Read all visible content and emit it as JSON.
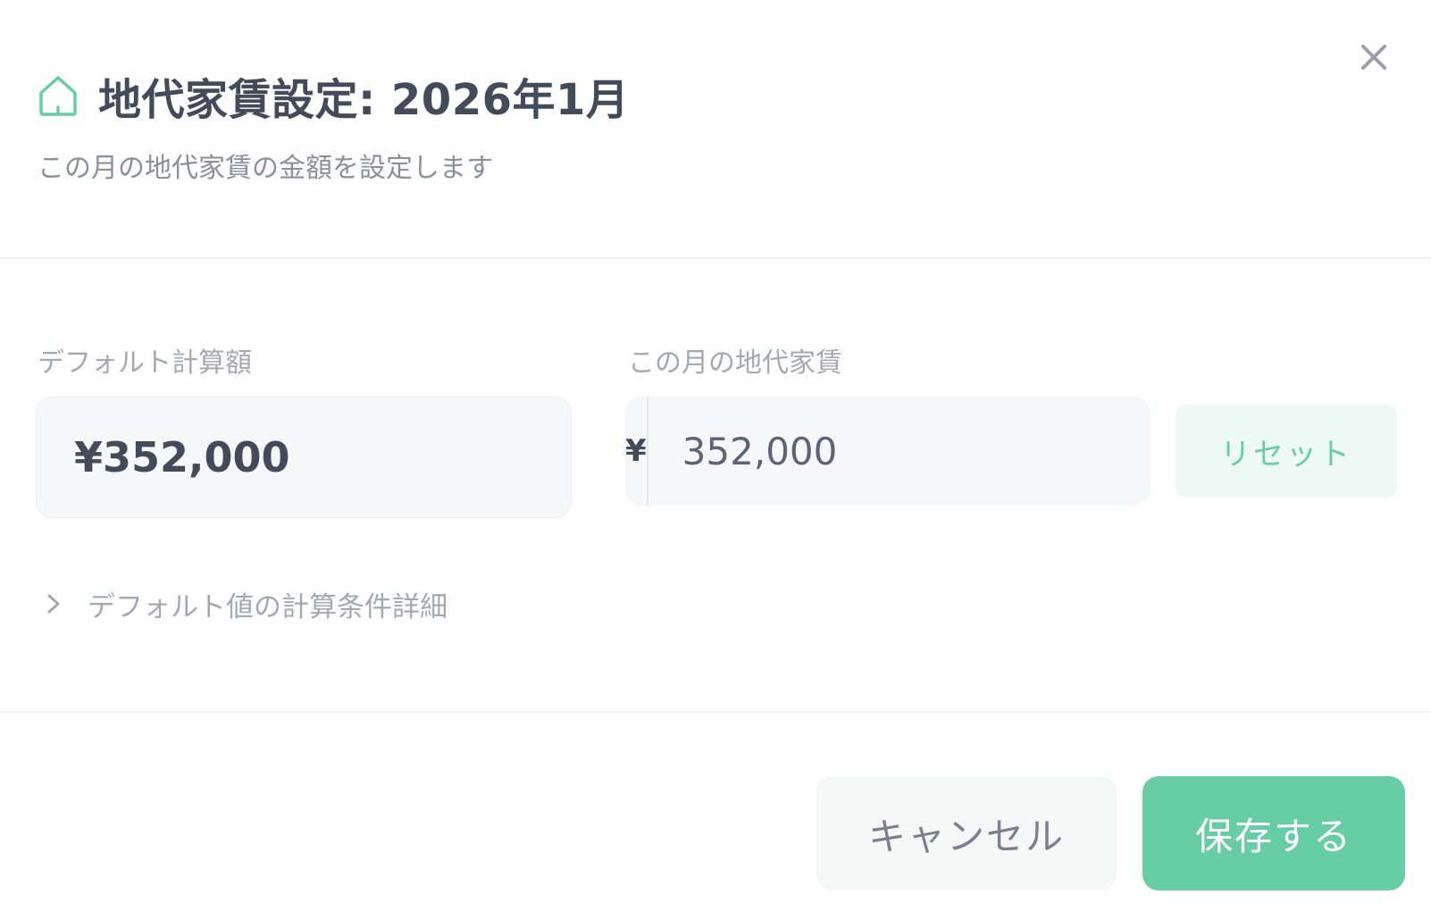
{
  "header": {
    "title": "地代家賃設定: 2026年1月",
    "subtitle": "この月の地代家賃の金額を設定します",
    "icon": "home-icon",
    "close_icon": "close-icon"
  },
  "default_field": {
    "label": "デフォルト計算額",
    "value": "¥352,000"
  },
  "rent_field": {
    "label": "この月の地代家賃",
    "currency_symbol": "¥",
    "value": "352,000",
    "reset_label": "リセット"
  },
  "details": {
    "label": "デフォルト値の計算条件詳細",
    "icon": "chevron-right-icon"
  },
  "footer": {
    "cancel_label": "キャンセル",
    "save_label": "保存する"
  },
  "colors": {
    "accent": "#66cda5",
    "accent_light": "#eef8f4",
    "text_dark": "#434a5a",
    "text_muted": "#a3a8b3"
  }
}
